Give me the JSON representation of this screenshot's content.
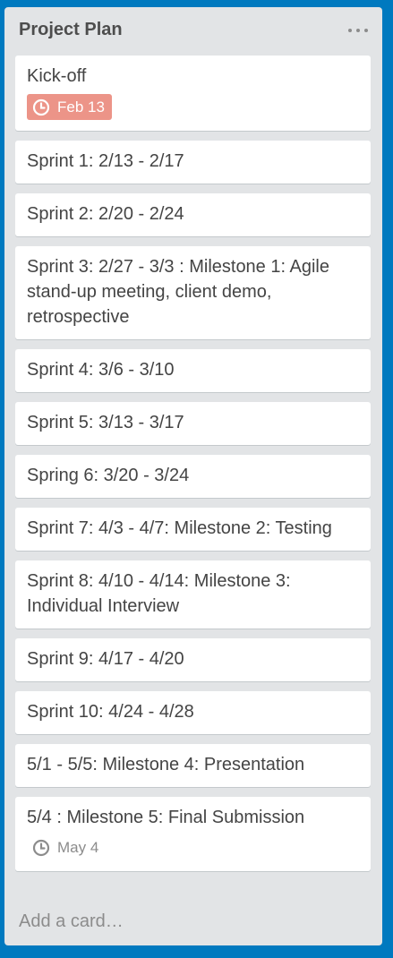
{
  "list": {
    "title": "Project Plan",
    "menu_icon": "ellipsis-icon",
    "add_card_label": "Add a card…",
    "cards": [
      {
        "title": "Kick-off",
        "badge": {
          "text": "Feb 13",
          "icon": "clock-icon",
          "style": "due",
          "color": "#ec9488"
        }
      },
      {
        "title": "Sprint 1: 2/13 - 2/17"
      },
      {
        "title": "Sprint 2: 2/20 - 2/24"
      },
      {
        "title": "Sprint 3: 2/27 - 3/3 : Milestone 1: Agile stand-up meeting, client demo, retrospective"
      },
      {
        "title": "Sprint 4: 3/6 - 3/10"
      },
      {
        "title": "Sprint 5: 3/13 - 3/17"
      },
      {
        "title": "Spring 6: 3/20 - 3/24"
      },
      {
        "title": "Sprint 7: 4/3 - 4/7: Milestone 2: Testing"
      },
      {
        "title": "Sprint 8: 4/10 - 4/14: Milestone 3: Individual Interview"
      },
      {
        "title": "Sprint 9: 4/17 - 4/20"
      },
      {
        "title": "Sprint 10: 4/24 - 4/28"
      },
      {
        "title": "5/1 - 5/5: Milestone 4: Presentation"
      },
      {
        "title": "5/4 : Milestone 5: Final Submission",
        "badge": {
          "text": "May 4",
          "icon": "clock-icon",
          "style": "plain",
          "color": "#8c8c8c"
        }
      }
    ]
  },
  "colors": {
    "board_background": "#0079bf",
    "list_background": "#e2e4e6",
    "card_background": "#ffffff"
  }
}
